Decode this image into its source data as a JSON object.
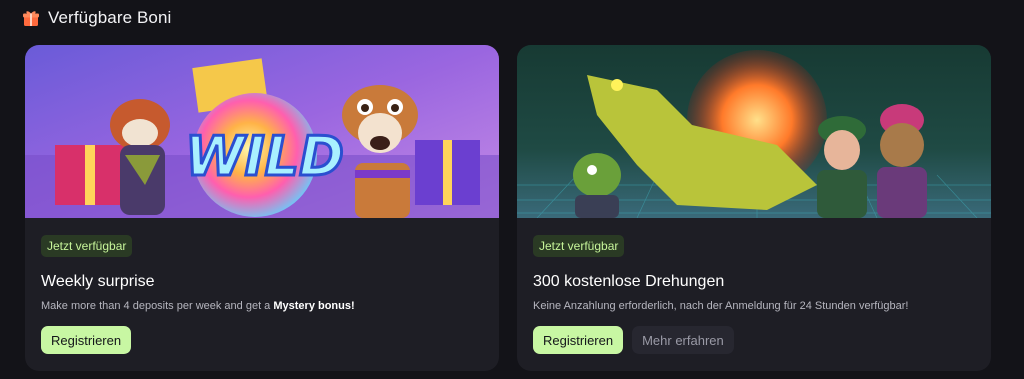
{
  "section": {
    "title": "Verfügbare Boni",
    "icon": "gift-icon"
  },
  "bonuses": [
    {
      "badge": "Jetzt verfügbar",
      "title": "Weekly surprise",
      "desc_before": "Make more than 4 deposits per week and get a ",
      "desc_bold": "Mystery bonus!",
      "banner_word": "WILD",
      "register_label": "Registrieren"
    },
    {
      "badge": "Jetzt verfügbar",
      "title": "300 kostenlose Drehungen",
      "desc": "Keine Anzahlung erforderlich, nach der Anmeldung für 24 Stunden verfügbar!",
      "register_label": "Registrieren",
      "more_label": "Mehr erfahren"
    }
  ],
  "colors": {
    "page_bg": "#131318",
    "card_bg": "#1e1e25",
    "badge_bg": "#2a3a24",
    "badge_text": "#c7f59a",
    "primary_button": "#c8f7a3",
    "secondary_button": "#272730",
    "gift_icon": "#ff6a3d"
  }
}
